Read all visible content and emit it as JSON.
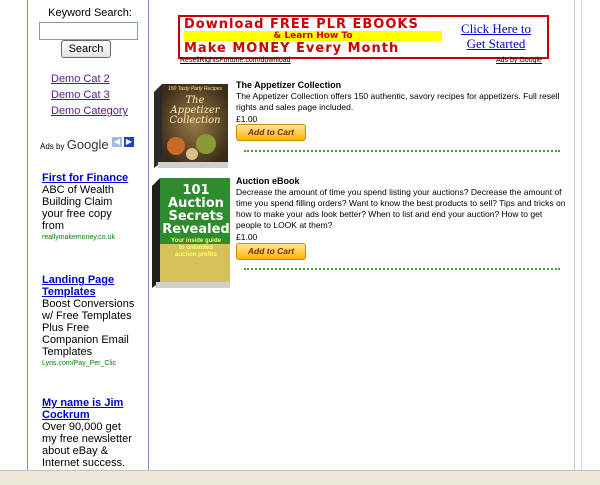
{
  "search": {
    "label": "Keyword Search:",
    "value": "",
    "button": "Search"
  },
  "categories": [
    "Demo Cat 2",
    "Demo Cat 3",
    "Demo Category"
  ],
  "ads_by_google": {
    "prefix": "Ads by",
    "brand": "Google"
  },
  "sidebar_ads": [
    {
      "title": "First for Finance",
      "lines": [
        "ABC of Wealth",
        "Building Claim",
        "your free copy",
        "from"
      ],
      "url": "reallymakemoney.co.uk"
    },
    {
      "title_lines": [
        "Landing Page",
        "Templates"
      ],
      "lines": [
        "Boost Conversions",
        "w/ Free Templates",
        "Plus Free",
        "Companion Email",
        "Templates"
      ],
      "url": "Lyris.com/Pay_Per_Clic"
    },
    {
      "title_lines": [
        "My name is Jim",
        "Cockrum"
      ],
      "lines": [
        "Over 90,000 get",
        "my free newsletter",
        "about eBay &",
        "Internet success."
      ],
      "url": ""
    }
  ],
  "banner": {
    "line1": "Download FREE PLR EBOOKS",
    "line2": "& Learn How To",
    "line3": "Make MONEY Every Month",
    "cta_lines": [
      "Click Here to",
      "Get Started"
    ],
    "source": "ResellRightsFortune.com/download",
    "ads_by": "Ads by Google"
  },
  "products": [
    {
      "title": "The Appetizer Collection",
      "description": "The Appetizer Collection offers 150 authentic, savory recipes for appetizers. Full resell rights and sales page included.",
      "price": "£1.00",
      "cart": "Add to Cart",
      "cover_top": "150 Tasty Party Recipes",
      "cover_title": [
        "The",
        "Appetizer",
        "Collection"
      ]
    },
    {
      "title": "Auction eBook",
      "description": "Decrease the amount of time you spend listing your auctions? Decrease the amount of time you spend filling orders? Want to know the best products to sell? Tips and tricks on how to make your ads look better? When to list and end your auction? How to get people to LOOK at them?",
      "price": "£1.00",
      "cart": "Add to Cart",
      "cover_title": [
        "101",
        "Auction",
        "Secrets",
        "Revealed"
      ],
      "cover_sub": [
        "Your inside guide",
        "to unlimited",
        "auction profits"
      ]
    }
  ],
  "colors": {
    "link": "#0000cc",
    "visited": "#551a8b",
    "banner_red": "#cc0000",
    "divider_green": "#3aa63a",
    "cart_orange": "#ffb400"
  }
}
